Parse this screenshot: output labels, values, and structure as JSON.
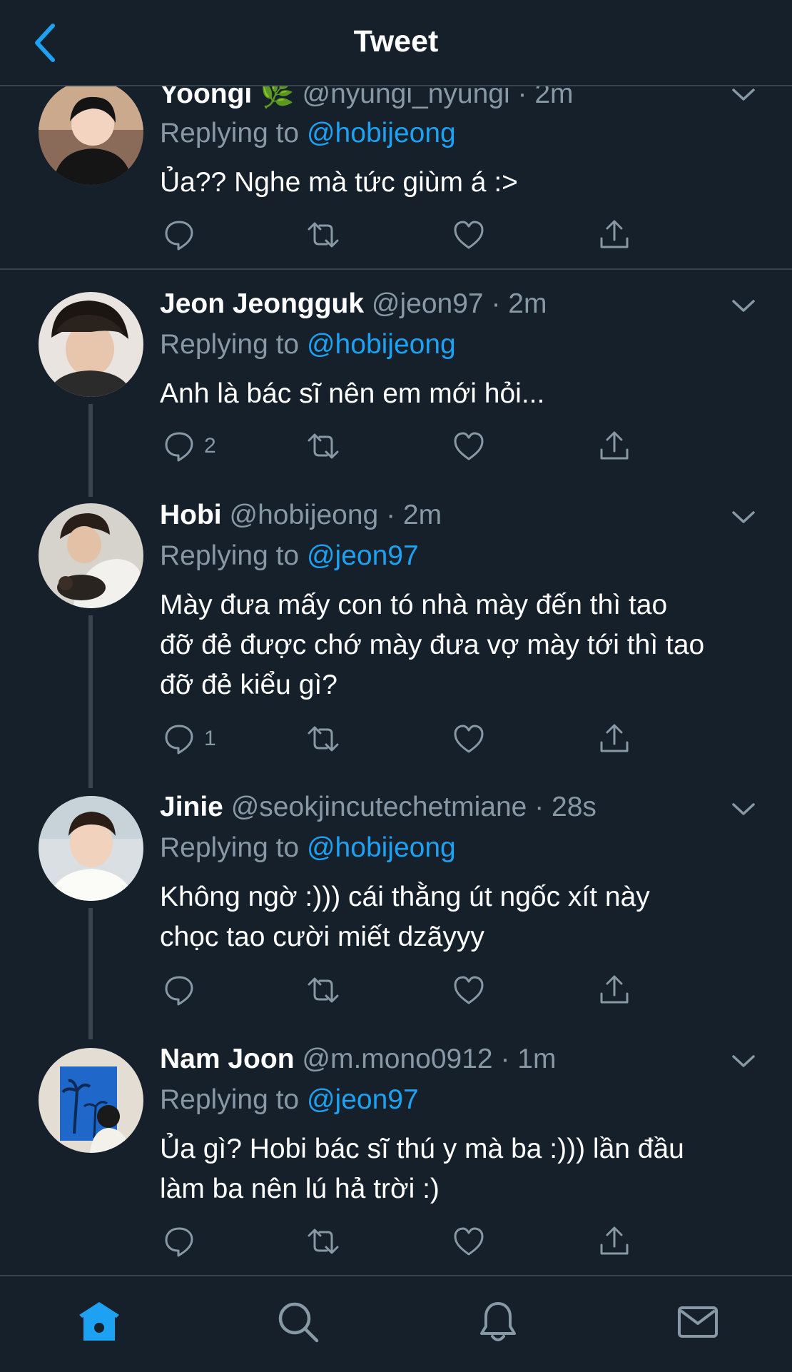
{
  "header": {
    "title": "Tweet"
  },
  "tweets": [
    {
      "name": "Yoongi",
      "emoji": "🌿",
      "handle": "@nyungi_nyungi",
      "time": "2m",
      "replying_prefix": "Replying to",
      "replying_to": "@hobijeong",
      "lines": [
        "Ủa?? Nghe mà tức giùm á :>"
      ],
      "reply_count": ""
    },
    {
      "name": "Jeon Jeongguk",
      "handle": "@jeon97",
      "time": "2m",
      "replying_prefix": "Replying to",
      "replying_to": "@hobijeong",
      "lines": [
        "Anh là bác sĩ nên em mới hỏi..."
      ],
      "reply_count": "2"
    },
    {
      "name": "Hobi",
      "handle": "@hobijeong",
      "time": "2m",
      "replying_prefix": "Replying to",
      "replying_to": "@jeon97",
      "lines": [
        "Mày đưa mấy con tó nhà mày đến thì tao",
        "đỡ đẻ được chớ mày đưa vợ mày tới thì tao",
        "đỡ đẻ kiểu gì?"
      ],
      "reply_count": "1"
    },
    {
      "name": "Jinie",
      "handle": "@seokjincutechetmiane",
      "time": "28s",
      "replying_prefix": "Replying to",
      "replying_to": "@hobijeong",
      "lines": [
        "Không ngờ :))) cái thằng út ngốc xít này",
        "chọc tao cười miết dzãyyy"
      ],
      "reply_count": ""
    },
    {
      "name": "Nam Joon",
      "handle": "@m.mono0912",
      "time": "1m",
      "replying_prefix": "Replying to",
      "replying_to": "@jeon97",
      "lines": [
        "Ủa gì? Hobi bác sĩ thú y mà ba :))) lần đầu",
        "làm ba nên lú hả trời :)"
      ],
      "reply_count": ""
    }
  ],
  "icons": {
    "back": "chevron-left-icon",
    "reply": "reply-bubble-icon",
    "retweet": "retweet-icon",
    "like": "heart-icon",
    "share": "share-icon",
    "caret": "chevron-down-icon",
    "tabs": [
      "home-icon",
      "search-icon",
      "bell-icon",
      "mail-icon"
    ]
  },
  "colors": {
    "background": "#15202b",
    "accent": "#1da1f2",
    "secondary_text": "#8899a6",
    "divider": "#38444d"
  }
}
